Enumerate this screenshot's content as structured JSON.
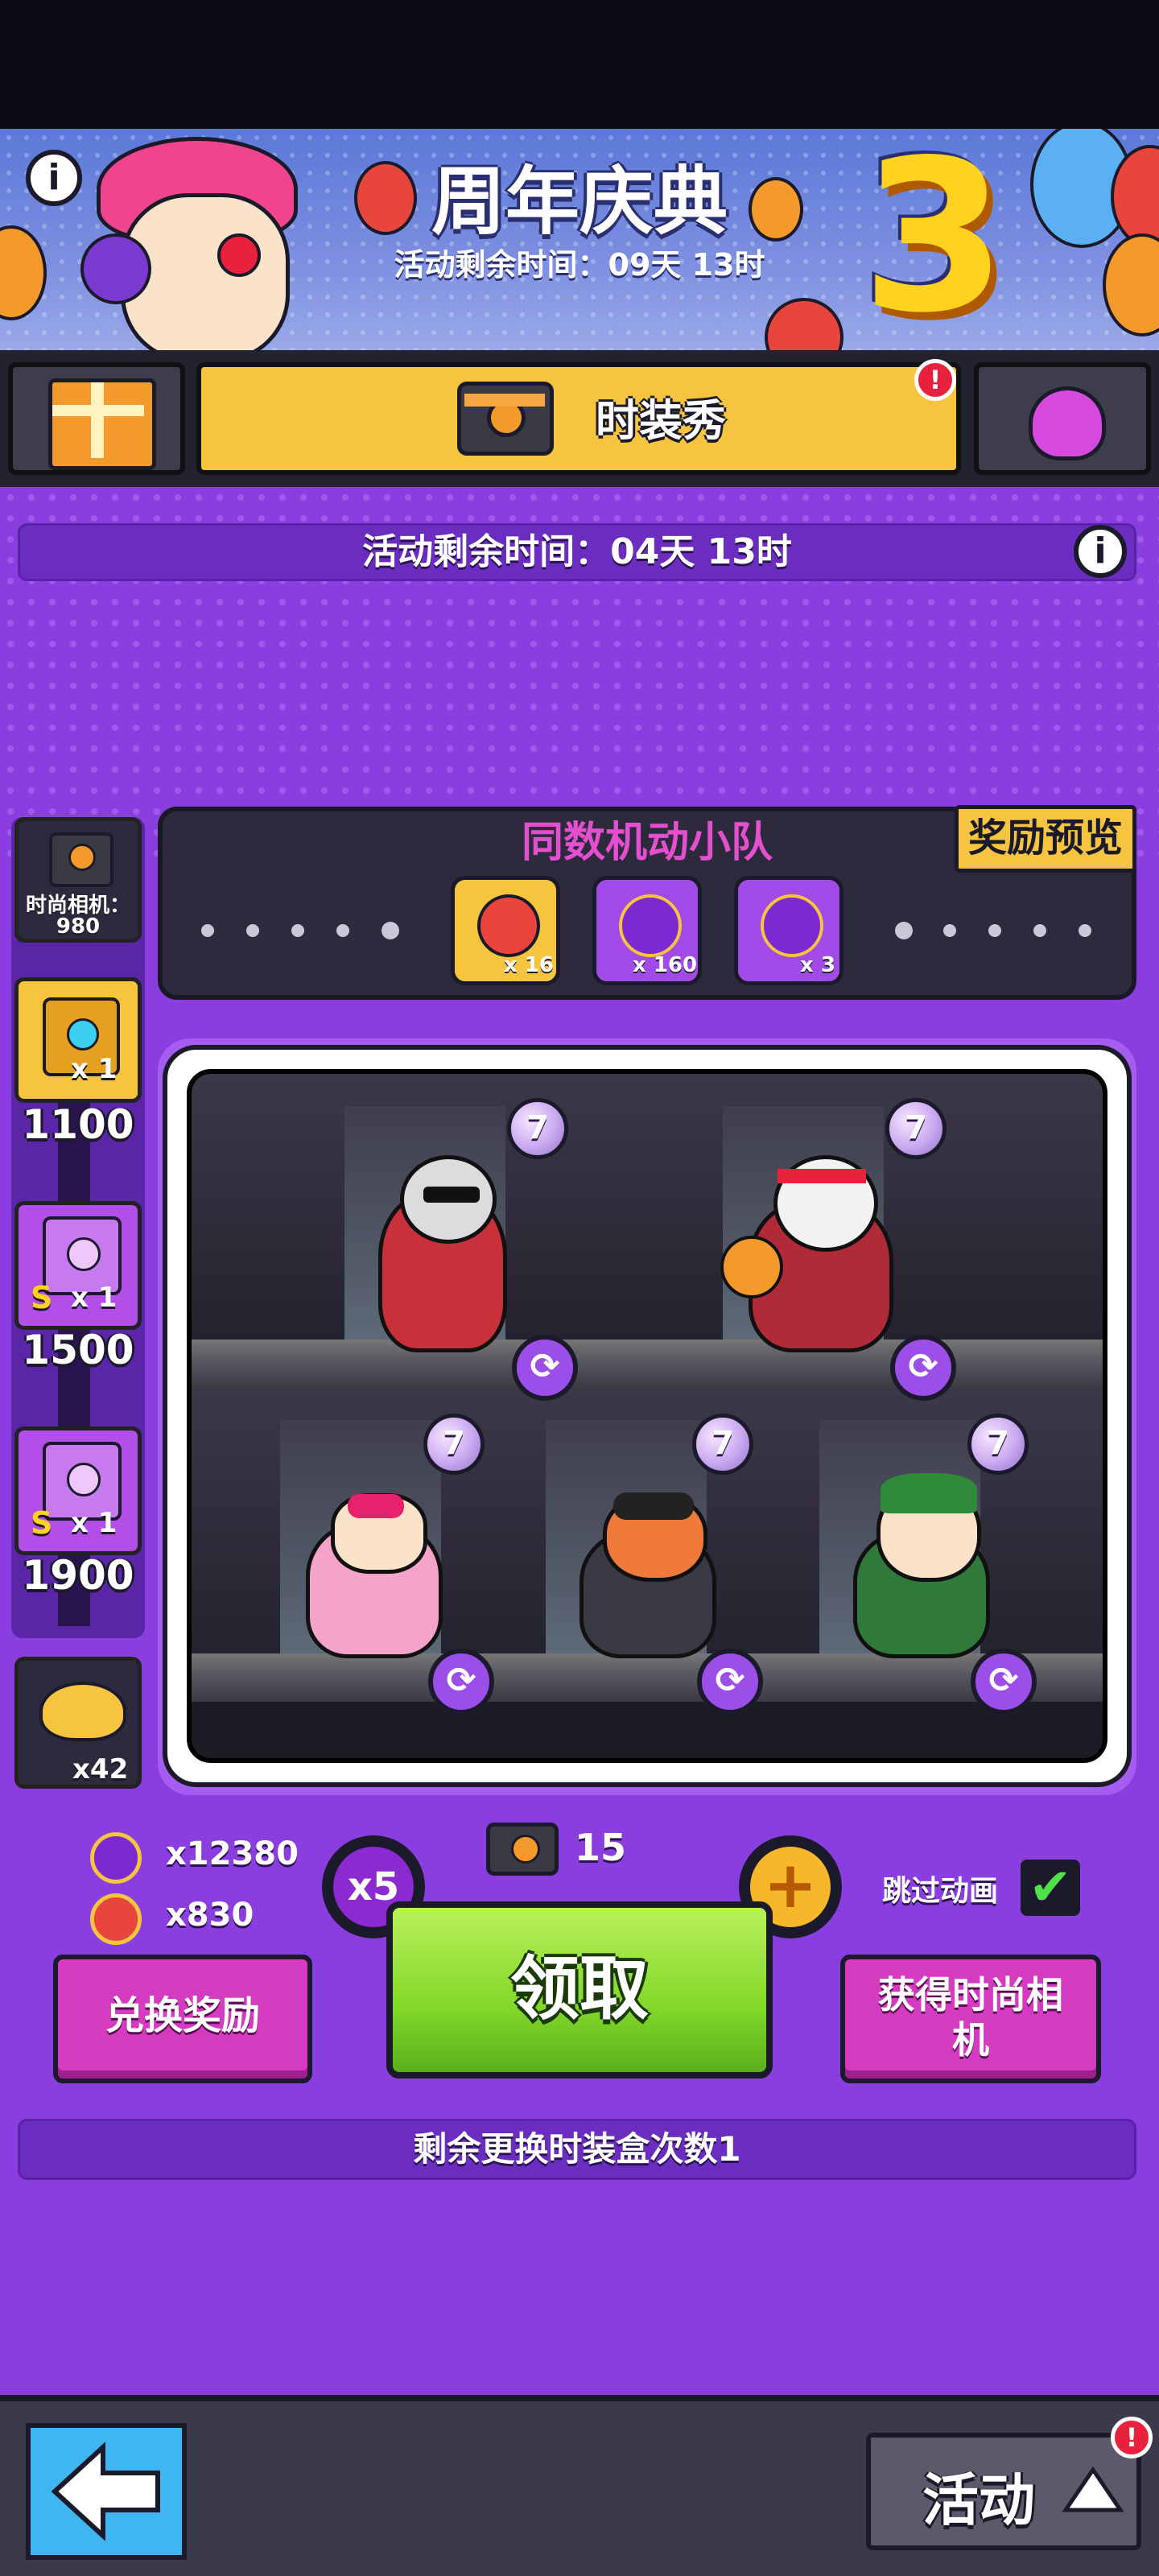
{
  "header": {
    "title": "周年庆典",
    "subtitle": "活动剩余时间：09天 13时",
    "anniversary_number": "3",
    "info_icon": "i"
  },
  "tabs": {
    "gift_icon": "gift-box-icon",
    "main_label": "时装秀",
    "main_icon": "camera-icon",
    "alert": "!",
    "shell_icon": "shell-icon"
  },
  "event": {
    "timer": "活动剩余时间：04天 13时",
    "info_icon": "i"
  },
  "sidebar": {
    "camera_label": "时尚相机：",
    "camera_count": "980",
    "rewards": [
      {
        "badge": "x 1",
        "threshold": "1100",
        "icon": "treasure-chest-icon"
      },
      {
        "badge": "x 1",
        "prefix": "S",
        "threshold": "1500",
        "icon": "purple-chest-icon"
      },
      {
        "badge": "x 1",
        "prefix": "S",
        "threshold": "1900",
        "icon": "purple-chest-icon"
      }
    ],
    "mask_count": "x42"
  },
  "squad": {
    "title": "同数机动小队",
    "preview_label": "奖励预览",
    "medals": [
      {
        "count": "x 16",
        "icon": "gold-star-medal-icon"
      },
      {
        "count": "x 160",
        "icon": "purple-star-medal-icon"
      },
      {
        "count": "x 3",
        "icon": "crown-medal-icon"
      }
    ]
  },
  "stage": {
    "top_row": [
      {
        "name": "cat-rapper",
        "level": "7"
      },
      {
        "name": "panda-basketball",
        "level": "7"
      }
    ],
    "bottom_row": [
      {
        "name": "girl-heart-glasses",
        "level": "7"
      },
      {
        "name": "girl-guitar",
        "level": "7"
      },
      {
        "name": "elf-santa",
        "level": "7"
      }
    ]
  },
  "currencies": [
    {
      "icon": "purple-star-coin-icon",
      "value": "x12380"
    },
    {
      "icon": "red-star-coin-icon",
      "value": "x830"
    }
  ],
  "controls": {
    "multiplier": "x5",
    "camera_count": "15",
    "plus": "+",
    "skip_label": "跳过动画",
    "skip_checked": "✔",
    "exchange_label": "兑换奖励",
    "claim_label": "领取",
    "get_camera_label": "获得时尚相机",
    "remaining_changes": "剩余更换时装盒次数1"
  },
  "bottom": {
    "back_icon": "back-arrow-icon",
    "activity_label": "活动",
    "activity_alert": "!"
  },
  "colors": {
    "background_purple": "#8a3ee0",
    "tab_yellow": "#f6c43e",
    "claim_green": "#83d82a",
    "pink_button": "#d43bc0",
    "back_blue": "#3fb6f2"
  }
}
